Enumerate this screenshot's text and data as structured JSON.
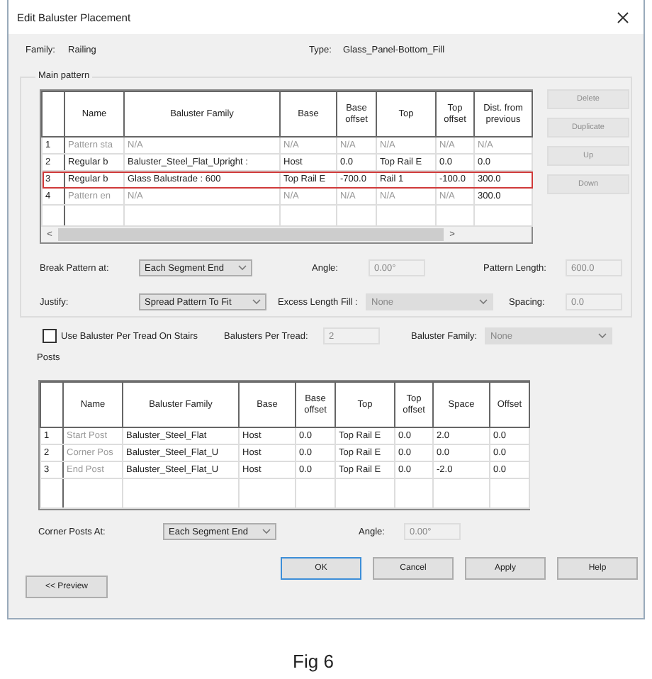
{
  "window": {
    "title": "Edit Baluster Placement"
  },
  "family": {
    "label": "Family:",
    "value": "Railing"
  },
  "type": {
    "label": "Type:",
    "value": "Glass_Panel-Bottom_Fill"
  },
  "main_pattern": {
    "title": "Main pattern",
    "columns": [
      "Name",
      "Baluster Family",
      "Base",
      "Base offset",
      "Top",
      "Top offset",
      "Dist. from previous"
    ],
    "rows": [
      {
        "number": "1",
        "highlighted": false,
        "cells": [
          {
            "text": "Pattern sta",
            "dim": true
          },
          {
            "text": "N/A",
            "dim": true
          },
          {
            "text": "N/A",
            "dim": true
          },
          {
            "text": "N/A",
            "dim": true
          },
          {
            "text": "N/A",
            "dim": true
          },
          {
            "text": "N/A",
            "dim": true
          },
          {
            "text": "N/A",
            "dim": true
          }
        ]
      },
      {
        "number": "2",
        "highlighted": false,
        "cells": [
          {
            "text": "Regular b",
            "dim": false
          },
          {
            "text": "Baluster_Steel_Flat_Upright :",
            "dim": false
          },
          {
            "text": "Host",
            "dim": false
          },
          {
            "text": "0.0",
            "dim": false
          },
          {
            "text": "Top Rail E",
            "dim": false
          },
          {
            "text": "0.0",
            "dim": false
          },
          {
            "text": "0.0",
            "dim": false
          }
        ]
      },
      {
        "number": "3",
        "highlighted": true,
        "cells": [
          {
            "text": "Regular b",
            "dim": false
          },
          {
            "text": "Glass Balustrade : 600",
            "dim": false
          },
          {
            "text": "Top Rail E",
            "dim": false
          },
          {
            "text": "-700.0",
            "dim": false
          },
          {
            "text": "Rail 1",
            "dim": false
          },
          {
            "text": "-100.0",
            "dim": false
          },
          {
            "text": "300.0",
            "dim": false
          }
        ]
      },
      {
        "number": "4",
        "highlighted": false,
        "cells": [
          {
            "text": "Pattern en",
            "dim": true
          },
          {
            "text": "N/A",
            "dim": true
          },
          {
            "text": "N/A",
            "dim": true
          },
          {
            "text": "N/A",
            "dim": true
          },
          {
            "text": "N/A",
            "dim": true
          },
          {
            "text": "N/A",
            "dim": true
          },
          {
            "text": "300.0",
            "dim": false
          }
        ]
      }
    ],
    "scroll_left": "<",
    "scroll_right": ">",
    "side_buttons": [
      {
        "label": "Delete",
        "disabled": true
      },
      {
        "label": "Duplicate",
        "disabled": true
      },
      {
        "label": "Up",
        "disabled": true
      },
      {
        "label": "Down",
        "disabled": true
      }
    ]
  },
  "pattern_fields": [
    [
      {
        "kind": "dropdown",
        "label": "Break Pattern at:",
        "value": "Each Segment End",
        "disabled": false
      },
      {
        "kind": "text",
        "label": "Angle:",
        "value": "0.00°",
        "disabled": true
      },
      {
        "kind": "text",
        "label": "Pattern Length:",
        "value": "600.0",
        "disabled": true
      }
    ],
    [
      {
        "kind": "dropdown",
        "label": "Justify:",
        "value": "Spread Pattern To Fit",
        "disabled": false
      },
      {
        "kind": "dropdown",
        "label": "Excess Length Fill :",
        "value": "None",
        "disabled": true
      },
      {
        "kind": "text",
        "label": "Spacing:",
        "value": "0.0",
        "disabled": true
      }
    ]
  ],
  "per_tread": {
    "label": "Use Baluster Per Tread On Stairs",
    "checked": false
  },
  "tread_fields": [
    {
      "kind": "text",
      "label": "Balusters Per Tread:",
      "value": "2",
      "disabled": true
    },
    {
      "kind": "dropdown",
      "label": "Baluster Family:",
      "value": "None",
      "disabled": true
    }
  ],
  "posts": {
    "title": "Posts",
    "columns": [
      "Name",
      "Baluster Family",
      "Base",
      "Base offset",
      "Top",
      "Top offset",
      "Space",
      "Offset"
    ],
    "rows": [
      {
        "number": "1",
        "cells": [
          {
            "text": "Start Post",
            "dim": true
          },
          {
            "text": "Baluster_Steel_Flat",
            "dim": false
          },
          {
            "text": "Host",
            "dim": false
          },
          {
            "text": "0.0",
            "dim": false
          },
          {
            "text": "Top Rail E",
            "dim": false
          },
          {
            "text": "0.0",
            "dim": false
          },
          {
            "text": "2.0",
            "dim": false
          },
          {
            "text": "0.0",
            "dim": false
          }
        ]
      },
      {
        "number": "2",
        "cells": [
          {
            "text": "Corner Pos",
            "dim": true
          },
          {
            "text": "Baluster_Steel_Flat_U",
            "dim": false
          },
          {
            "text": "Host",
            "dim": false
          },
          {
            "text": "0.0",
            "dim": false
          },
          {
            "text": "Top Rail E",
            "dim": false
          },
          {
            "text": "0.0",
            "dim": false
          },
          {
            "text": "0.0",
            "dim": false
          },
          {
            "text": "0.0",
            "dim": false
          }
        ]
      },
      {
        "number": "3",
        "cells": [
          {
            "text": "End Post",
            "dim": true
          },
          {
            "text": "Baluster_Steel_Flat_U",
            "dim": false
          },
          {
            "text": "Host",
            "dim": false
          },
          {
            "text": "0.0",
            "dim": false
          },
          {
            "text": "Top Rail E",
            "dim": false
          },
          {
            "text": "0.0",
            "dim": false
          },
          {
            "text": "-2.0",
            "dim": false
          },
          {
            "text": "0.0",
            "dim": false
          }
        ]
      }
    ]
  },
  "corner_fields": [
    {
      "kind": "dropdown",
      "label": "Corner Posts At:",
      "value": "Each Segment End",
      "disabled": false
    },
    {
      "kind": "text",
      "label": "Angle:",
      "value": "0.00°",
      "disabled": true
    }
  ],
  "buttons": [
    {
      "label": "OK",
      "default": true
    },
    {
      "label": "Cancel",
      "default": false
    },
    {
      "label": "Apply",
      "default": false
    },
    {
      "label": "Help",
      "default": false
    }
  ],
  "preview_button": {
    "label": "<< Preview"
  },
  "caption": "Fig 6"
}
